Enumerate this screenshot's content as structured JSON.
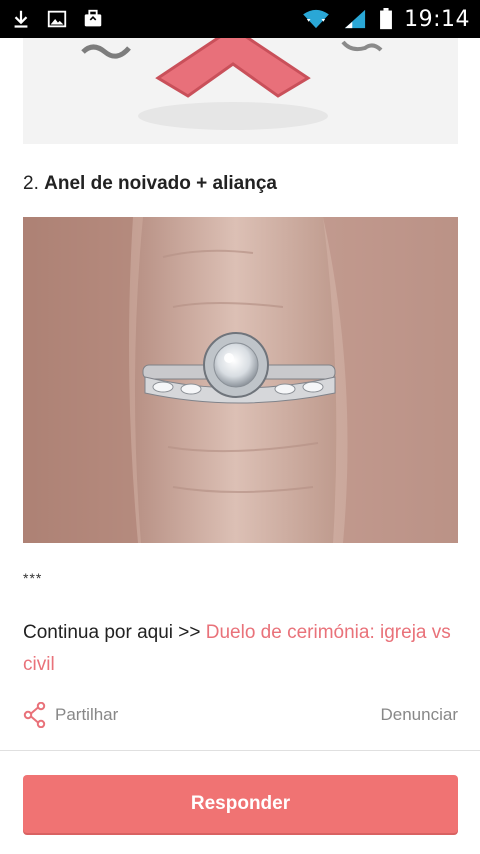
{
  "status_bar": {
    "time": "19:14",
    "left_icons": [
      "download-icon",
      "image-icon",
      "briefcase-icon"
    ],
    "right_icons": [
      "wifi-icon",
      "signal-icon",
      "battery-icon"
    ]
  },
  "post": {
    "section_number": "2.",
    "section_title": "Anel de noivado + aliança",
    "separator": "***",
    "continue_prefix": "Continua por aqui >> ",
    "continue_link": "Duelo de cerimónia: igreja vs civil"
  },
  "actions": {
    "share_label": "Partilhar",
    "report_label": "Denunciar"
  },
  "footer": {
    "reply_label": "Responder"
  },
  "colors": {
    "accent": "#f07373",
    "link": "#e9727a",
    "muted": "#888888"
  }
}
